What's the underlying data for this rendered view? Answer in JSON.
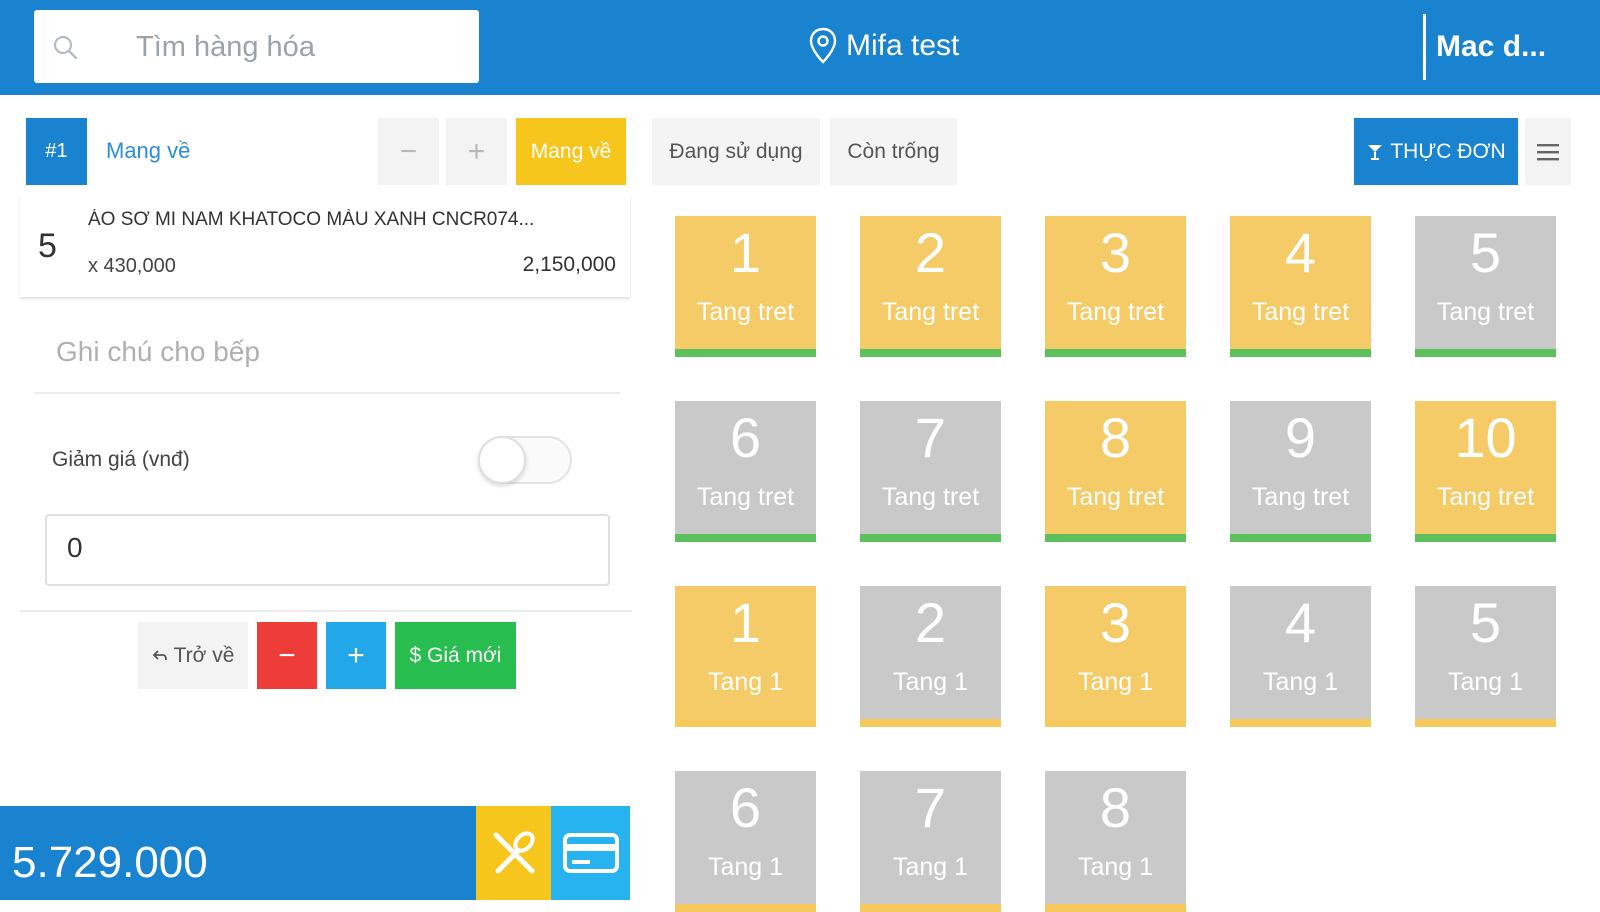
{
  "header": {
    "search_placeholder": "Tìm hàng hóa",
    "location": "Mifa test",
    "user": "Mac d..."
  },
  "order": {
    "tab_label": "#1",
    "type_link": "Mang về",
    "qty_minus": "−",
    "qty_plus": "+",
    "takeaway_label": "Mang về",
    "item": {
      "qty": "5",
      "name": "ÁO SƠ MI NAM KHATOCO MÀU XANH CNCR074...",
      "unit_price": "x 430,000",
      "total": "2,150,000"
    },
    "note_placeholder": "Ghi chú cho bếp",
    "discount_label": "Giảm giá (vnđ)",
    "discount_enabled": false,
    "discount_value": "0",
    "buttons": {
      "back": "Trở về",
      "minus": "−",
      "plus": "+",
      "new_price": "$ Giá mới"
    },
    "grand_total": "5.729.000"
  },
  "filters": {
    "in_use": "Đang sử dụng",
    "free": "Còn trống",
    "menu": "THỰC ĐƠN"
  },
  "colors": {
    "primary": "#1a83cf",
    "occupied": "#f5cb68",
    "vacant": "#c9c9c9",
    "bar_ground": "#5cc05c",
    "bar_floor1": "#f6c95c"
  },
  "tables": [
    {
      "num": "1",
      "area": "Tang tret",
      "status": "occupied",
      "floor": "ground"
    },
    {
      "num": "2",
      "area": "Tang tret",
      "status": "occupied",
      "floor": "ground"
    },
    {
      "num": "3",
      "area": "Tang tret",
      "status": "occupied",
      "floor": "ground"
    },
    {
      "num": "4",
      "area": "Tang tret",
      "status": "occupied",
      "floor": "ground"
    },
    {
      "num": "5",
      "area": "Tang tret",
      "status": "vacant",
      "floor": "ground"
    },
    {
      "num": "6",
      "area": "Tang tret",
      "status": "vacant",
      "floor": "ground"
    },
    {
      "num": "7",
      "area": "Tang tret",
      "status": "vacant",
      "floor": "ground"
    },
    {
      "num": "8",
      "area": "Tang tret",
      "status": "occupied",
      "floor": "ground"
    },
    {
      "num": "9",
      "area": "Tang tret",
      "status": "vacant",
      "floor": "ground"
    },
    {
      "num": "10",
      "area": "Tang tret",
      "status": "occupied",
      "floor": "ground"
    },
    {
      "num": "1",
      "area": "Tang 1",
      "status": "occupied",
      "floor": "first"
    },
    {
      "num": "2",
      "area": "Tang 1",
      "status": "vacant",
      "floor": "first"
    },
    {
      "num": "3",
      "area": "Tang 1",
      "status": "occupied",
      "floor": "first"
    },
    {
      "num": "4",
      "area": "Tang 1",
      "status": "vacant",
      "floor": "first"
    },
    {
      "num": "5",
      "area": "Tang 1",
      "status": "vacant",
      "floor": "first"
    },
    {
      "num": "6",
      "area": "Tang 1",
      "status": "vacant",
      "floor": "first"
    },
    {
      "num": "7",
      "area": "Tang 1",
      "status": "vacant",
      "floor": "first"
    },
    {
      "num": "8",
      "area": "Tang 1",
      "status": "vacant",
      "floor": "first"
    }
  ]
}
